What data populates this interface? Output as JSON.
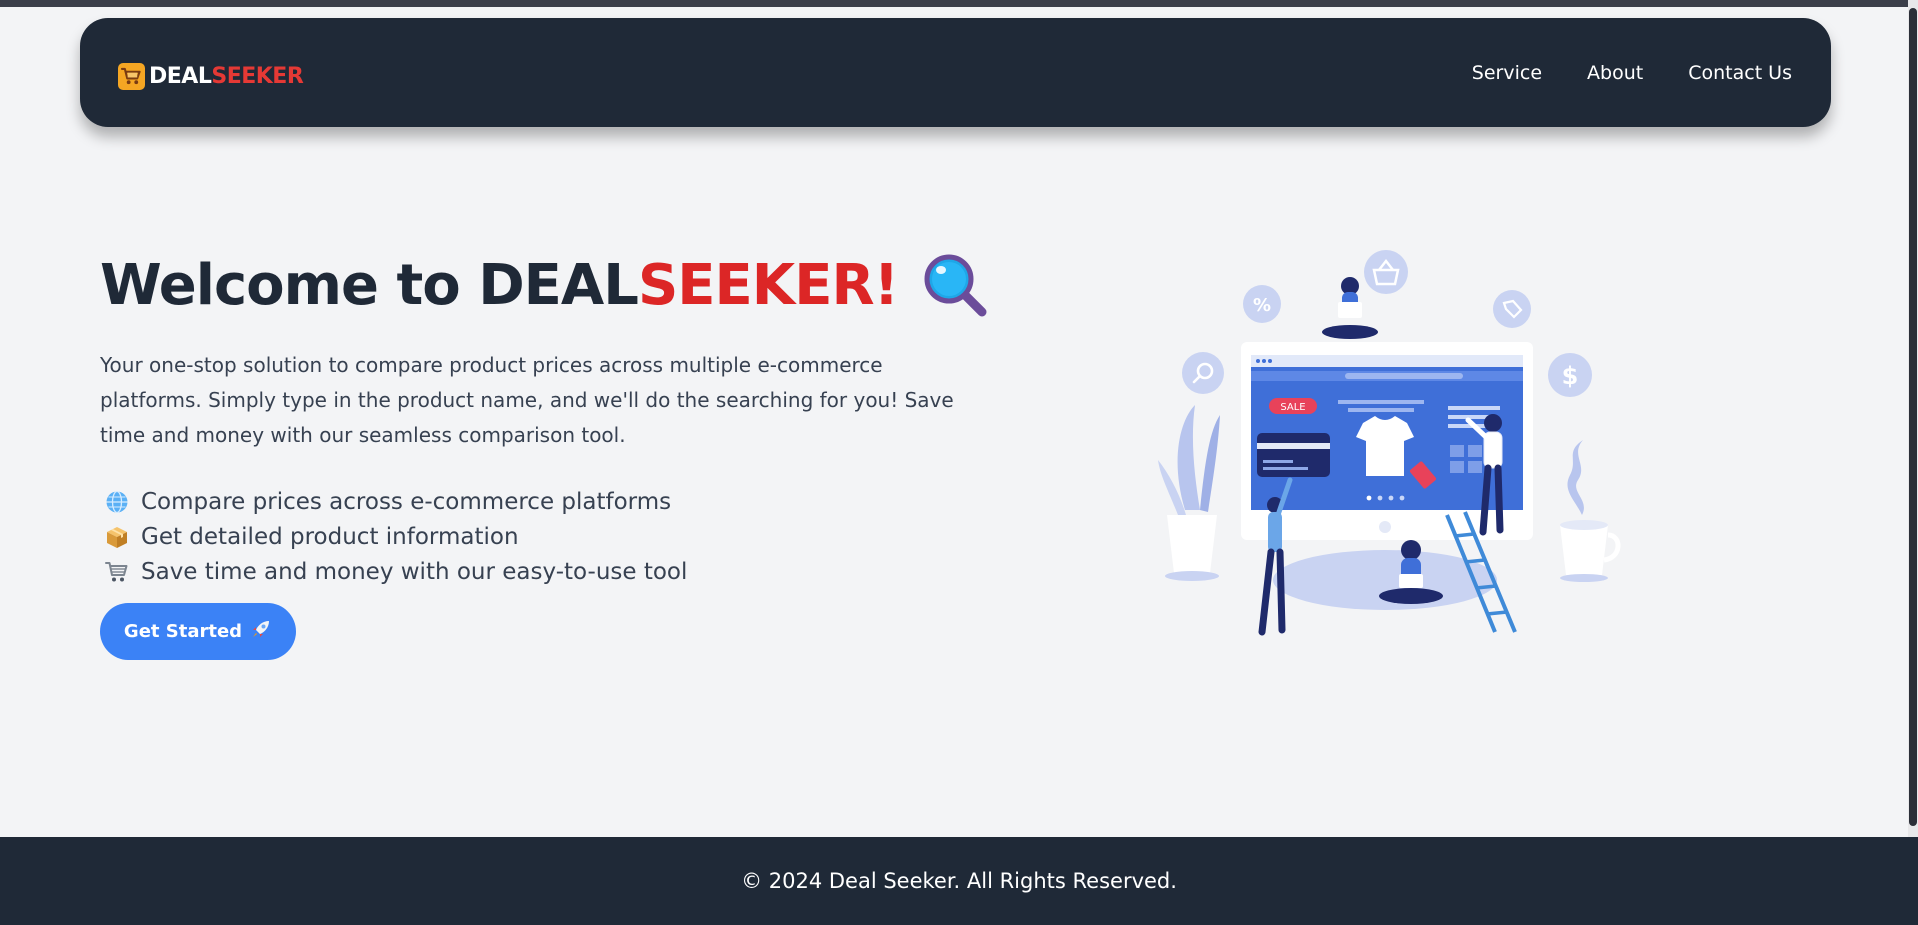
{
  "brand": {
    "part1": "DEAL",
    "part2": "SEEKER",
    "icon": "shopping-cart-icon",
    "accent_color": "#e53935"
  },
  "nav": {
    "items": [
      {
        "label": "Service"
      },
      {
        "label": "About"
      },
      {
        "label": "Contact Us"
      }
    ]
  },
  "hero": {
    "title_prefix": "Welcome to ",
    "title_brand1": "DEAL",
    "title_brand2": "SEEKER!",
    "title_icon": "magnifying-glass-icon",
    "description": "Your one-stop solution to compare product prices across multiple e-commerce platforms. Simply type in the product name, and we'll do the searching for you! Save time and money with our seamless comparison tool.",
    "features": [
      {
        "icon": "globe-icon",
        "text": "Compare prices across e-commerce platforms"
      },
      {
        "icon": "package-icon",
        "text": "Get detailed product information"
      },
      {
        "icon": "shopping-cart-icon",
        "text": "Save time and money with our easy-to-use tool"
      }
    ],
    "cta_label": "Get Started",
    "cta_icon": "rocket-icon",
    "illustration": {
      "sale_badge": "SALE",
      "percent_symbol": "%",
      "dollar_symbol": "$"
    }
  },
  "footer": {
    "text": "© 2024 Deal Seeker. All Rights Reserved."
  },
  "colors": {
    "navbar_bg": "#1f2937",
    "page_bg": "#f3f4f6",
    "button_bg": "#3b82f6",
    "title_accent": "#dc2626"
  }
}
